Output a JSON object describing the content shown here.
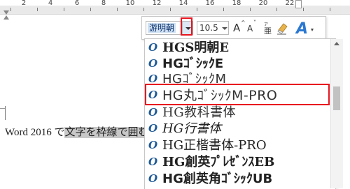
{
  "ruler": {
    "numbers": [
      "2",
      "4",
      "6",
      "8",
      "10",
      "12",
      "14",
      "16",
      "18",
      "20",
      "22"
    ]
  },
  "document": {
    "text_plain": "Word 2016 で",
    "text_selected": "文字を枠線で囲む"
  },
  "mini_toolbar": {
    "font_name": "游明朝",
    "font_size": "10.5",
    "grow_font_glyph": "A",
    "shrink_font_glyph": "A",
    "texteffect_glyph": "A"
  },
  "font_list": {
    "items": [
      {
        "label": "HGS明朝E"
      },
      {
        "label": "HGｺﾞｼｯｸE"
      },
      {
        "label": "HGｺﾞｼｯｸM"
      },
      {
        "label": "HG丸ｺﾞｼｯｸM-PRO"
      },
      {
        "label": "HG教科書体"
      },
      {
        "label": "HG行書体"
      },
      {
        "label": "HG正楷書体-PRO"
      },
      {
        "label": "HG創英ﾌﾟﾚｾﾞﾝｽEB"
      },
      {
        "label": "HG創英角ｺﾞｼｯｸUB"
      }
    ],
    "highlighted_index": 3
  },
  "colors": {
    "highlight_red": "#e8141f",
    "font_icon_blue": "#1f5a96",
    "selection_gray": "#c8c8c8",
    "texteffect_blue": "#2b78d0"
  },
  "icons": {
    "font_item": "truetype-o-icon",
    "grow_font": "grow-font-icon",
    "shrink_font": "shrink-font-icon",
    "phonetic": "phonetic-guide-icon",
    "eraser": "clear-formatting-icon",
    "texteffect": "text-effect-icon"
  }
}
